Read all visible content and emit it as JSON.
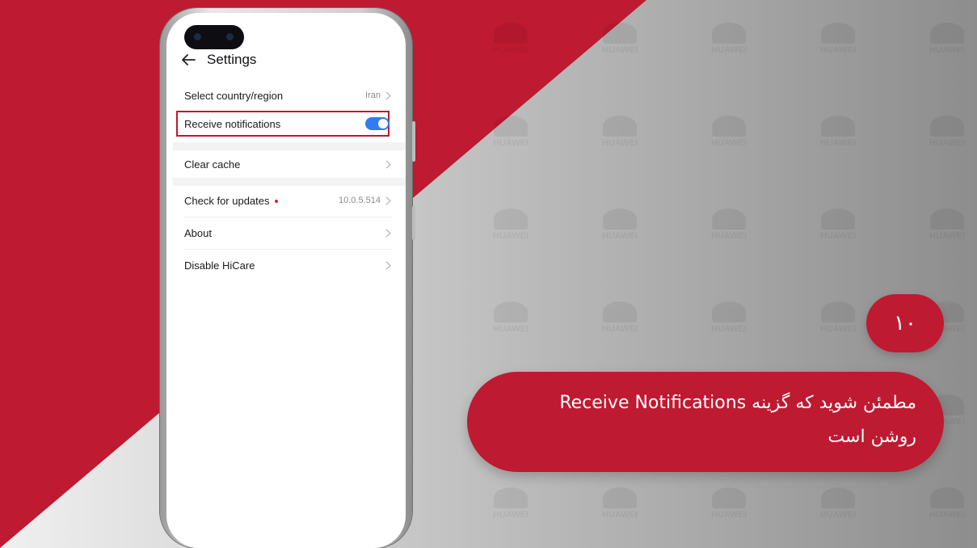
{
  "colors": {
    "brand_red": "#be1a31",
    "toggle_on": "#2f7df1",
    "highlight_border": "#c0172e",
    "bg_gray_light": "#ededed",
    "bg_gray_dark": "#8f8f8f"
  },
  "watermark": {
    "text": "HUAWEI",
    "icon": "huawei-flower-logo"
  },
  "phone": {
    "header": {
      "back_icon": "arrow-left-icon",
      "title": "Settings"
    },
    "settings": {
      "country": {
        "label": "Select country/region",
        "value": "Iran"
      },
      "notifications": {
        "label": "Receive notifications",
        "toggle_on": true
      },
      "cache": {
        "label": "Clear cache"
      },
      "updates": {
        "label": "Check for updates",
        "value": "10.0.5.514",
        "has_badge_dot": true
      },
      "about": {
        "label": "About"
      },
      "disable": {
        "label": "Disable HiCare"
      }
    }
  },
  "step": {
    "number": "۱۰",
    "caption_line1": "مطمئن شوید که گزینه Receive Notifications",
    "caption_line2": "روشن است"
  }
}
